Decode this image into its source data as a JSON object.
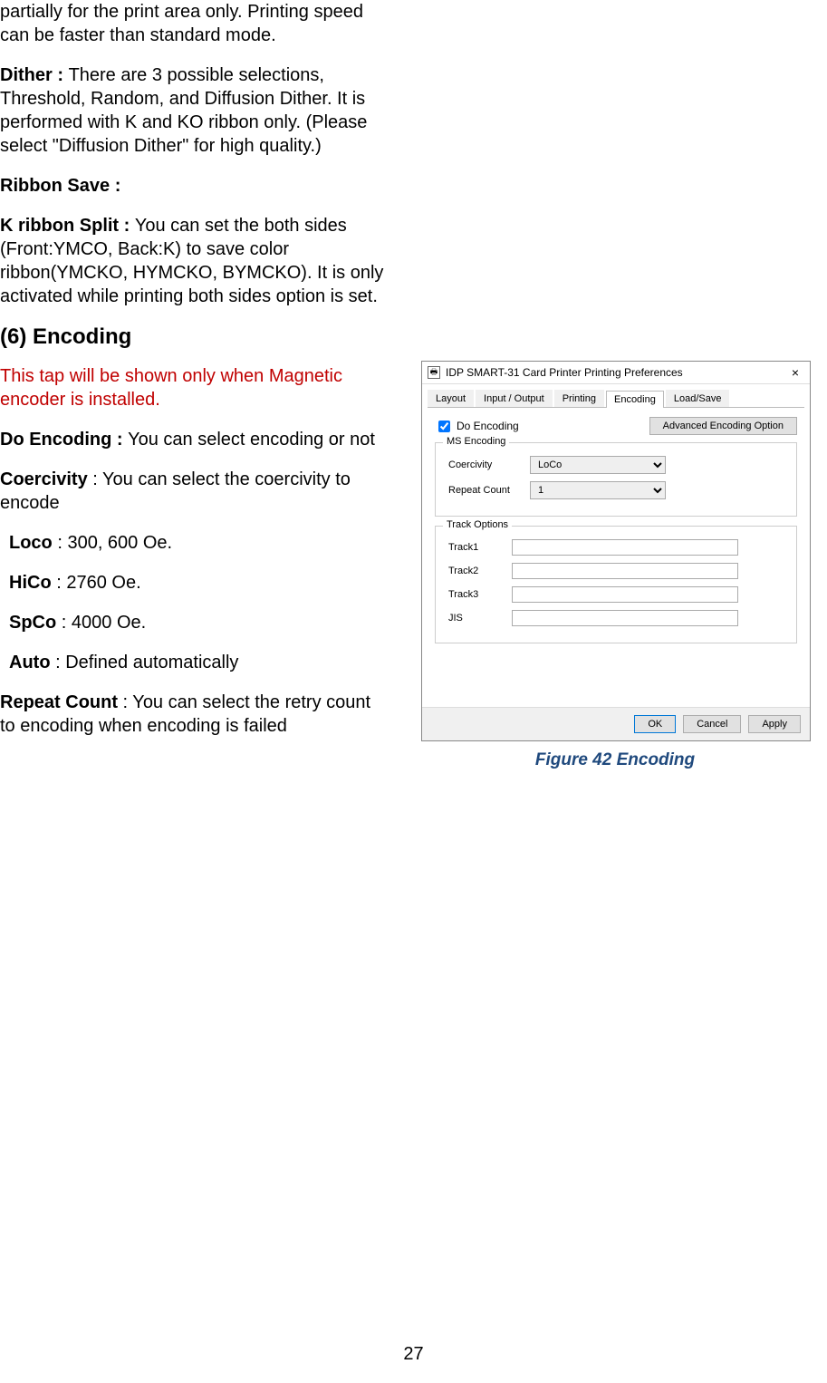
{
  "para": {
    "p1": "partially for the print area only. Printing speed can be faster than standard mode.",
    "p2_bold": "Dither : ",
    "p2_rest": "There are 3 possible selections, Threshold, Random, and Diffusion Dither. It is performed with K and KO ribbon only. (Please select \"Diffusion Dither\" for high quality.)",
    "p3": "Ribbon Save :",
    "p4_bold": "K ribbon Split : ",
    "p4_rest": "You can set the both sides (Front:YMCO, Back:K) to save color ribbon(YMCKO, HYMCKO, BYMCKO). It is only activated while printing both sides option is set.",
    "heading": "(6) Encoding",
    "red": "This tap will be shown only when Magnetic encoder is installed.",
    "p5_bold": "Do Encoding : ",
    "p5_rest": "You can select encoding or not",
    "p6_bold": "Coercivity",
    "p6_rest": " : You can select the coercivity to encode",
    "loco_b": "Loco",
    "loco_r": " : 300, 600 Oe.",
    "hico_b": "HiCo",
    "hico_r": " : 2760 Oe.",
    "spco_b": "SpCo",
    "spco_r": " : 4000 Oe.",
    "auto_b": "Auto",
    "auto_r": " : Defined automatically",
    "p7_bold": "Repeat Count",
    "p7_rest": " : You can select the retry count to encoding when encoding is failed"
  },
  "dialog": {
    "title": "IDP SMART-31 Card Printer Printing Preferences",
    "close": "×",
    "tabs": {
      "layout": "Layout",
      "input": "Input / Output",
      "printing": "Printing",
      "encoding": "Encoding",
      "load": "Load/Save"
    },
    "check_label": "Do Encoding",
    "adv_btn": "Advanced Encoding Option",
    "group1": "MS Encoding",
    "coercivity_label": "Coercivity",
    "coercivity_value": "LoCo",
    "repeat_label": "Repeat Count",
    "repeat_value": "1",
    "group2": "Track Options",
    "track1": "Track1",
    "track2": "Track2",
    "track3": "Track3",
    "jis": "JIS",
    "ok": "OK",
    "cancel": "Cancel",
    "apply": "Apply"
  },
  "caption": "Figure 42 Encoding",
  "page_number": "27"
}
